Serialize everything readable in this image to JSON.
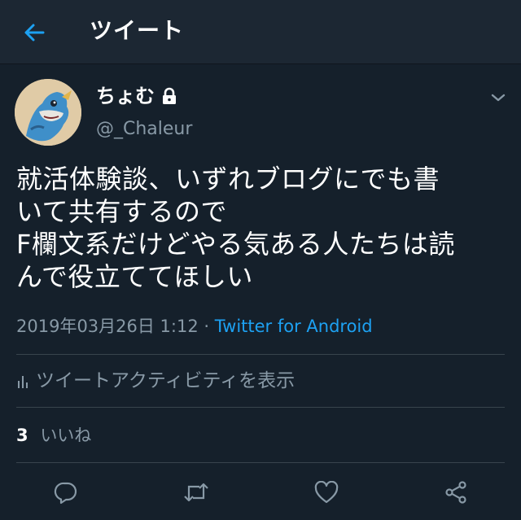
{
  "header": {
    "title": "ツイート"
  },
  "author": {
    "display_name": "ちょむ",
    "handle": "@_Chaleur"
  },
  "tweet": {
    "text": "就活体験談、いずれブログにでも書\nいて共有するので\nF欄文系だけどやる気ある人たちは読\nんで役立ててほしい",
    "timestamp": "2019年03月26日 1:12",
    "separator": "·",
    "source": "Twitter for Android"
  },
  "activity": {
    "label": "ツイートアクティビティを表示"
  },
  "likes": {
    "count": "3",
    "label": "いいね"
  },
  "colors": {
    "background": "#15202b",
    "header": "#1c2733",
    "accent": "#1da1f2",
    "secondary_text": "#8899a6",
    "divider": "#38444d"
  },
  "icons": {
    "back": "arrow-left-icon",
    "lock": "lock-icon",
    "caret": "chevron-down-icon",
    "activity": "bar-chart-icon",
    "reply": "reply-icon",
    "retweet": "retweet-icon",
    "like": "heart-icon",
    "share": "share-icon"
  }
}
